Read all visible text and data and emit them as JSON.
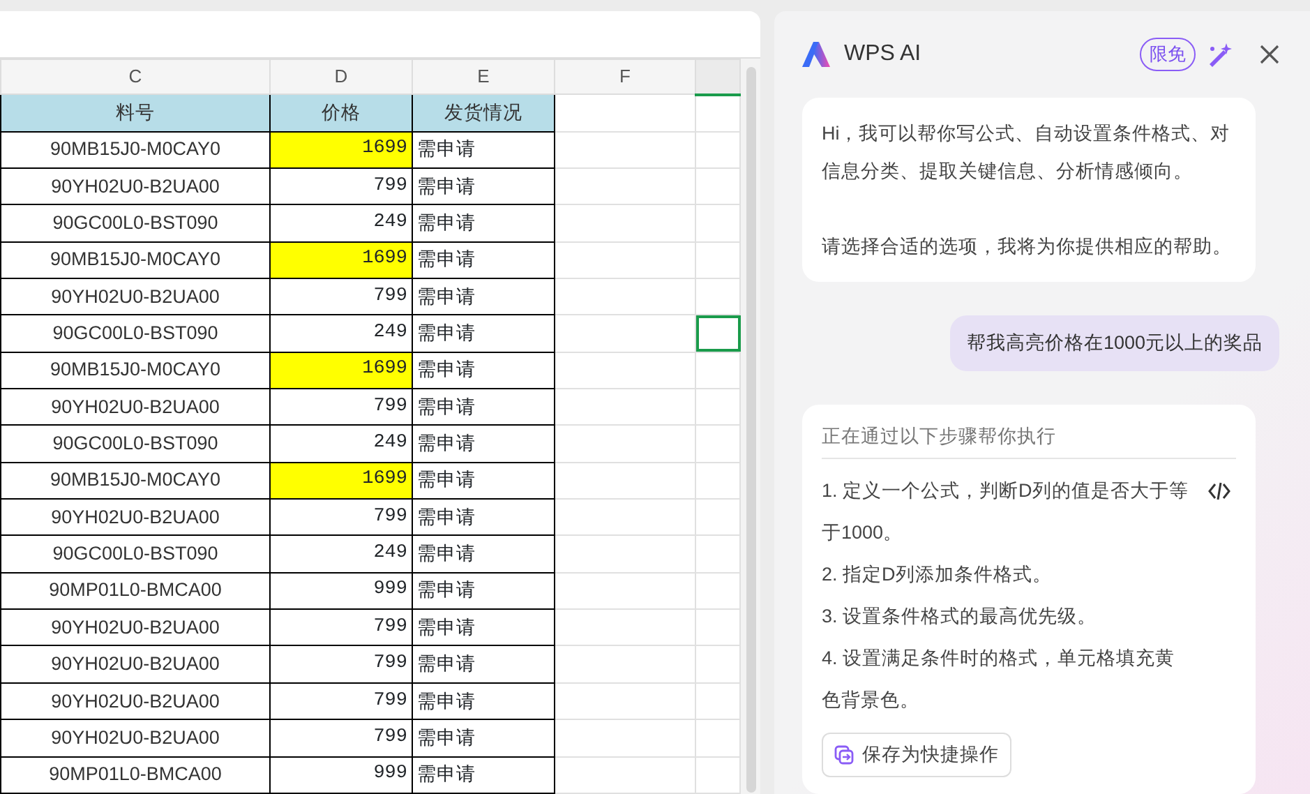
{
  "sheet": {
    "columns": [
      {
        "label": "C",
        "selected": false
      },
      {
        "label": "D",
        "selected": false
      },
      {
        "label": "E",
        "selected": false
      },
      {
        "label": "F",
        "selected": false
      },
      {
        "selected": true
      }
    ],
    "header": [
      "料号",
      "价格",
      "发货情况"
    ],
    "rows": [
      {
        "part": "90MB15J0-M0CAY0",
        "price": "1699",
        "highlight": true,
        "status": "需申请",
        "cursor": false
      },
      {
        "part": "90YH02U0-B2UA00",
        "price": "799",
        "highlight": false,
        "status": "需申请",
        "cursor": false
      },
      {
        "part": "90GC00L0-BST090",
        "price": "249",
        "highlight": false,
        "status": "需申请",
        "cursor": false
      },
      {
        "part": "90MB15J0-M0CAY0",
        "price": "1699",
        "highlight": true,
        "status": "需申请",
        "cursor": false
      },
      {
        "part": "90YH02U0-B2UA00",
        "price": "799",
        "highlight": false,
        "status": "需申请",
        "cursor": false
      },
      {
        "part": "90GC00L0-BST090",
        "price": "249",
        "highlight": false,
        "status": "需申请",
        "cursor": true
      },
      {
        "part": "90MB15J0-M0CAY0",
        "price": "1699",
        "highlight": true,
        "status": "需申请",
        "cursor": false
      },
      {
        "part": "90YH02U0-B2UA00",
        "price": "799",
        "highlight": false,
        "status": "需申请",
        "cursor": false
      },
      {
        "part": "90GC00L0-BST090",
        "price": "249",
        "highlight": false,
        "status": "需申请",
        "cursor": false
      },
      {
        "part": "90MB15J0-M0CAY0",
        "price": "1699",
        "highlight": true,
        "status": "需申请",
        "cursor": false
      },
      {
        "part": "90YH02U0-B2UA00",
        "price": "799",
        "highlight": false,
        "status": "需申请",
        "cursor": false
      },
      {
        "part": "90GC00L0-BST090",
        "price": "249",
        "highlight": false,
        "status": "需申请",
        "cursor": false
      },
      {
        "part": "90MP01L0-BMCA00",
        "price": "999",
        "highlight": false,
        "status": "需申请",
        "cursor": false
      },
      {
        "part": "90YH02U0-B2UA00",
        "price": "799",
        "highlight": false,
        "status": "需申请",
        "cursor": false
      },
      {
        "part": "90YH02U0-B2UA00",
        "price": "799",
        "highlight": false,
        "status": "需申请",
        "cursor": false
      },
      {
        "part": "90YH02U0-B2UA00",
        "price": "799",
        "highlight": false,
        "status": "需申请",
        "cursor": false
      },
      {
        "part": "90YH02U0-B2UA00",
        "price": "799",
        "highlight": false,
        "status": "需申请",
        "cursor": false
      },
      {
        "part": "90MP01L0-BMCA00",
        "price": "999",
        "highlight": false,
        "status": "需申请",
        "cursor": false
      }
    ]
  },
  "ai_panel": {
    "title": "WPS AI",
    "badge": "限免",
    "greeting": [
      "Hi，我可以帮你写公式、自动设置条件格式、对信息分类、提取关键信息、分析情感倾向。",
      "请选择合适的选项，我将为你提供相应的帮助。"
    ],
    "user_message": "帮我高亮价格在1000元以上的奖品",
    "reply": {
      "heading": "正在通过以下步骤帮你执行",
      "steps": [
        "1. 定义一个公式，判断D列的值是否大于等于1000。",
        "2. 指定D列添加条件格式。",
        "3. 设置条件格式的最高优先级。",
        "4. 设置满足条件时的格式，单元格填充黄色背景色。"
      ],
      "save_button": "保存为快捷操作"
    }
  }
}
